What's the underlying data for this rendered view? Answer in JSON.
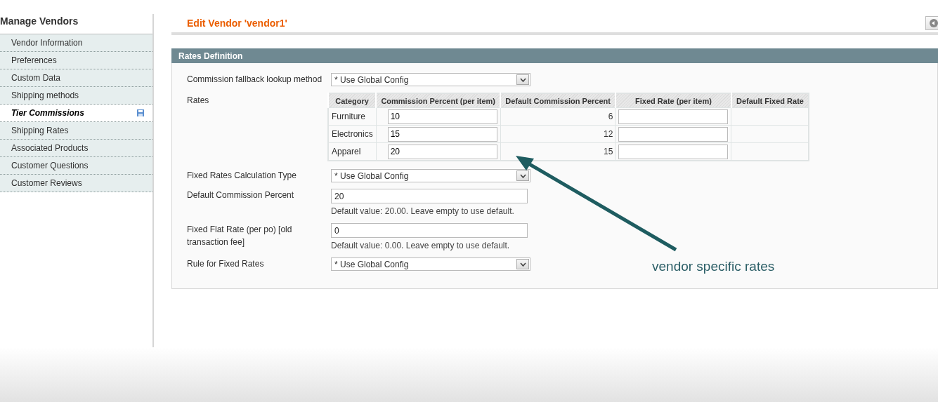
{
  "sidebar": {
    "title": "Manage Vendors",
    "items": [
      {
        "label": "Vendor Information",
        "selected": false,
        "changed": false
      },
      {
        "label": "Preferences",
        "selected": false,
        "changed": false
      },
      {
        "label": "Custom Data",
        "selected": false,
        "changed": false
      },
      {
        "label": "Shipping methods",
        "selected": false,
        "changed": false
      },
      {
        "label": "Tier Commissions",
        "selected": true,
        "changed": true
      },
      {
        "label": "Shipping Rates",
        "selected": false,
        "changed": false
      },
      {
        "label": "Associated Products",
        "selected": false,
        "changed": false
      },
      {
        "label": "Customer Questions",
        "selected": false,
        "changed": false
      },
      {
        "label": "Customer Reviews",
        "selected": false,
        "changed": false
      }
    ]
  },
  "page": {
    "title": "Edit Vendor 'vendor1'"
  },
  "section": {
    "title": "Rates Definition",
    "fields": [
      {
        "kind": "select",
        "label": "Commission fallback lookup method",
        "value": "* Use Global Config"
      },
      {
        "kind": "rates",
        "label": "Rates",
        "columns": [
          "Category",
          "Commission Percent (per item)",
          "Default Commission Percent",
          "Fixed Rate (per item)",
          "Default Fixed Rate"
        ],
        "rows": [
          {
            "category": "Furniture",
            "commission": "10",
            "default_commission": "6"
          },
          {
            "category": "Electronics",
            "commission": "15",
            "default_commission": "12"
          },
          {
            "category": "Apparel",
            "commission": "20",
            "default_commission": "15"
          }
        ]
      },
      {
        "kind": "select",
        "label": "Fixed Rates Calculation Type",
        "value": "* Use Global Config"
      },
      {
        "kind": "text",
        "label": "Default Commission Percent",
        "value": "20",
        "note": "Default value: 20.00. Leave empty to use default."
      },
      {
        "kind": "text",
        "label": "Fixed Flat Rate (per po) [old transaction fee]",
        "value": "0",
        "note": "Default value: 0.00. Leave empty to use default."
      },
      {
        "kind": "select",
        "label": "Rule for Fixed Rates",
        "value": "* Use Global Config"
      }
    ]
  },
  "annotation": {
    "text": "vendor specific rates"
  }
}
